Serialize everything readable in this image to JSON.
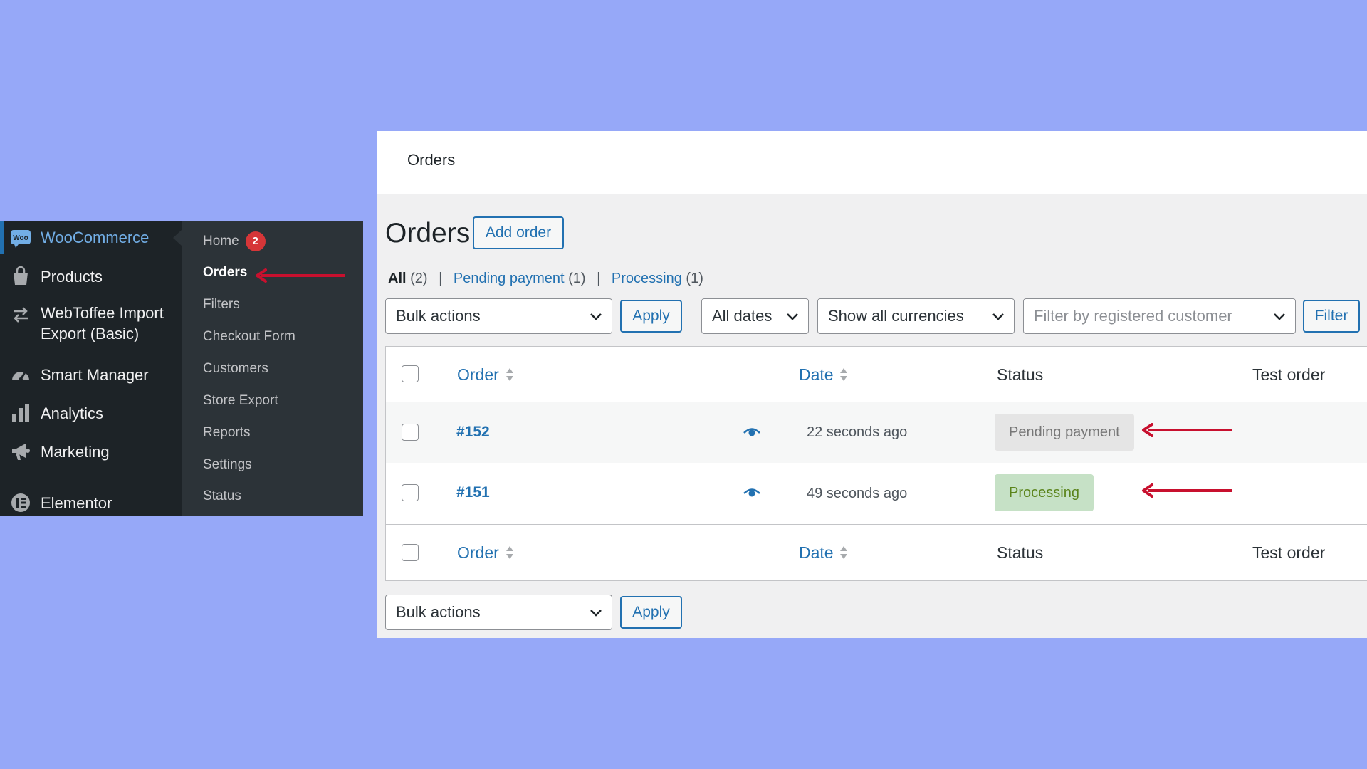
{
  "colors": {
    "background": "#96a8f8",
    "admin_menu_bg": "#1d2327",
    "admin_submenu_bg": "#2c3338",
    "wp_blue": "#2271b1",
    "annotation_arrow": "#c8102e"
  },
  "admin_menu": {
    "items": [
      {
        "label": "WooCommerce",
        "icon": "woo-icon"
      },
      {
        "label": "Products",
        "icon": "shopping-bag-icon"
      },
      {
        "label": "WebToffee Import\nExport (Basic)",
        "icon": "import-export-icon"
      },
      {
        "label": "Smart Manager",
        "icon": "dashboard-gauge-icon"
      },
      {
        "label": "Analytics",
        "icon": "bar-chart-icon"
      },
      {
        "label": "Marketing",
        "icon": "megaphone-icon"
      },
      {
        "label": "Elementor",
        "icon": "elementor-icon"
      }
    ],
    "woo_logo_text": "Woo",
    "submenu": [
      {
        "label": "Home",
        "badge": "2"
      },
      {
        "label": "Orders"
      },
      {
        "label": "Filters"
      },
      {
        "label": "Checkout Form"
      },
      {
        "label": "Customers"
      },
      {
        "label": "Store Export"
      },
      {
        "label": "Reports"
      },
      {
        "label": "Settings"
      },
      {
        "label": "Status"
      }
    ]
  },
  "orders_page": {
    "top_bar_title": "Orders",
    "title": "Orders",
    "add_order_label": "Add order",
    "views": [
      {
        "label": "All",
        "count": "(2)"
      },
      {
        "label": "Pending payment",
        "count": "(1)"
      },
      {
        "label": "Processing",
        "count": "(1)"
      }
    ],
    "filters": {
      "bulk_actions": "Bulk actions",
      "apply": "Apply",
      "all_dates": "All dates",
      "currencies": "Show all currencies",
      "customer_placeholder": "Filter by registered customer",
      "filter_button": "Filter"
    },
    "table": {
      "columns": [
        "Order",
        "Date",
        "Status",
        "Test order"
      ],
      "rows": [
        {
          "order": "#152",
          "date": "22 seconds ago",
          "status": "Pending payment"
        },
        {
          "order": "#151",
          "date": "49 seconds ago",
          "status": "Processing"
        }
      ]
    },
    "bottom": {
      "bulk_actions": "Bulk actions",
      "apply": "Apply"
    }
  }
}
